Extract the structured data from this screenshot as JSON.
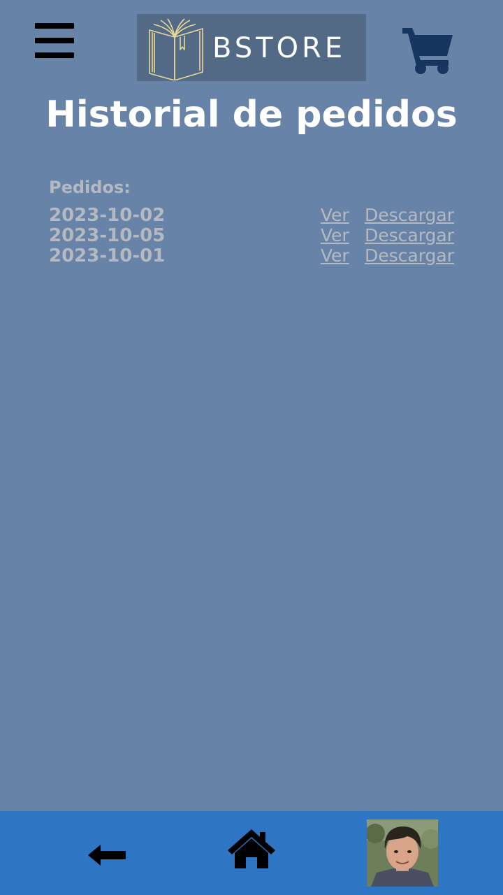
{
  "header": {
    "menu_icon": "hamburger-menu-icon",
    "logo_text": "BSTORE",
    "cart_icon": "shopping-cart-icon"
  },
  "page": {
    "title": "Historial de pedidos"
  },
  "orders": {
    "heading": "Pedidos:",
    "items": [
      {
        "date": "2023-10-02",
        "view_label": "Ver",
        "download_label": "Descargar"
      },
      {
        "date": "2023-10-05",
        "view_label": "Ver",
        "download_label": "Descargar"
      },
      {
        "date": "2023-10-01",
        "view_label": "Ver",
        "download_label": "Descargar"
      }
    ]
  },
  "bottom_nav": {
    "back_icon": "back-arrow-icon",
    "home_icon": "home-icon",
    "profile_icon": "profile-avatar"
  },
  "colors": {
    "background": "#6783a8",
    "bottom_bar": "#2e75c4",
    "cart": "#16365f",
    "muted_text": "#b5b9c0",
    "logo_bg": "#536a86",
    "logo_book": "#e8d99a"
  }
}
